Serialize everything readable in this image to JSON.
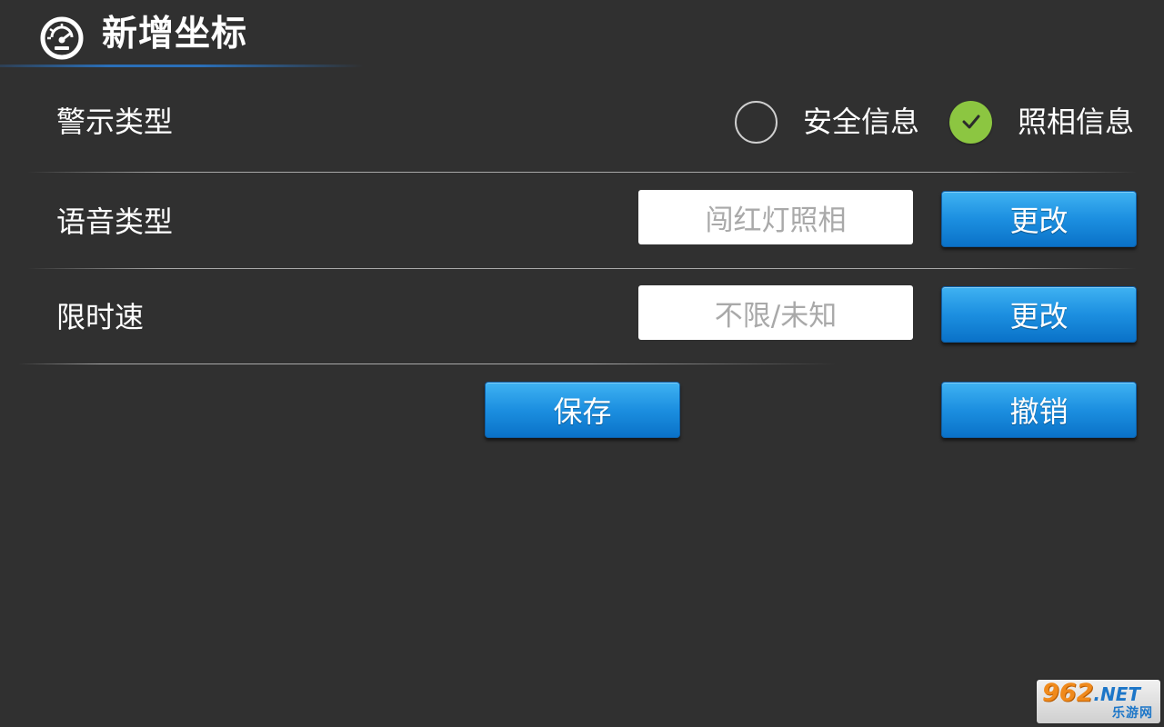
{
  "header": {
    "title": "新增坐标",
    "icon": "speedometer-icon"
  },
  "warning_type": {
    "label": "警示类型",
    "options": [
      {
        "label": "安全信息",
        "selected": false
      },
      {
        "label": "照相信息",
        "selected": true
      }
    ]
  },
  "voice_type": {
    "label": "语音类型",
    "value": "闯红灯照相",
    "change_label": "更改"
  },
  "speed_limit": {
    "label": "限时速",
    "value": "不限/未知",
    "change_label": "更改"
  },
  "actions": {
    "save_label": "保存",
    "cancel_label": "撤销"
  },
  "watermark": {
    "number": "962",
    "suffix": ".NET",
    "subtitle": "乐游网"
  },
  "colors": {
    "background": "#303030",
    "accent_blue": "#1c8fe0",
    "check_green": "#8cc641",
    "header_line": "#2a6fb8"
  }
}
